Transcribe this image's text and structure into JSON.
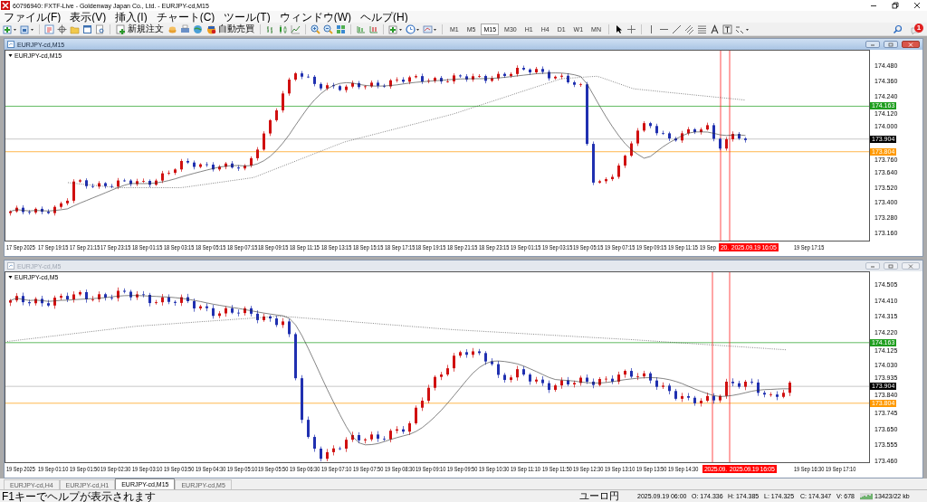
{
  "window": {
    "title": "60796940: FXTF-Live - Goldenway Japan Co., Ltd. - EURJPY-cd,M15"
  },
  "menu": [
    "ファイル(F)",
    "表示(V)",
    "挿入(I)",
    "チャート(C)",
    "ツール(T)",
    "ウィンドウ(W)",
    "ヘルプ(H)"
  ],
  "toolbar": {
    "new_order": "新規注文",
    "auto_trading": "自動売買",
    "notification_badge": "1",
    "timeframes": [
      {
        "label": "M1",
        "selected": false
      },
      {
        "label": "M5",
        "selected": false
      },
      {
        "label": "M15",
        "selected": true
      },
      {
        "label": "M30",
        "selected": false
      },
      {
        "label": "H1",
        "selected": false
      },
      {
        "label": "H4",
        "selected": false
      },
      {
        "label": "D1",
        "selected": false
      },
      {
        "label": "W1",
        "selected": false
      },
      {
        "label": "MN",
        "selected": false
      }
    ]
  },
  "charts": [
    {
      "title": "EURJPY-cd,M15",
      "active": true,
      "label": "EURJPY-cd,M15",
      "price_ticks": [
        "174.480",
        "174.360",
        "174.240",
        "174.120",
        "174.000",
        "173.760",
        "173.640",
        "173.520",
        "173.400",
        "173.280",
        "173.160"
      ],
      "price_tags": [
        {
          "text": "174.163",
          "color": "#1f9e1f"
        },
        {
          "text": "173.904",
          "color": "#000000"
        },
        {
          "text": "173.804",
          "color": "#ff9900"
        }
      ],
      "time_ticks": [
        "17 Sep 2025",
        "17 Sep 19:15",
        "17 Sep 21:15",
        "17 Sep 23:15",
        "18 Sep 01:15",
        "18 Sep 03:15",
        "18 Sep 05:15",
        "18 Sep 07:15",
        "18 Sep 09:15",
        "18 Sep 11:15",
        "18 Sep 13:15",
        "18 Sep 15:15",
        "18 Sep 17:15",
        "18 Sep 19:15",
        "18 Sep 21:15",
        "18 Sep 23:15",
        "19 Sep 01:15",
        "19 Sep 03:15",
        "19 Sep 05:15",
        "19 Sep 07:15",
        "19 Sep 09:15",
        "19 Sep 11:15",
        "19 Sep",
        "19 Sep 17:15"
      ],
      "cursor_labels": [
        "20.",
        "2025.09.19 16:05"
      ]
    },
    {
      "title": "EURJPY-cd,M5",
      "active": false,
      "label": "EURJPY-cd,M5",
      "price_ticks": [
        "174.505",
        "174.410",
        "174.315",
        "174.220",
        "174.125",
        "174.030",
        "173.935",
        "173.840",
        "173.745",
        "173.650",
        "173.555",
        "173.460"
      ],
      "price_tags": [
        {
          "text": "174.163",
          "color": "#1f9e1f"
        },
        {
          "text": "173.904",
          "color": "#000000"
        },
        {
          "text": "173.804",
          "color": "#ff9900"
        }
      ],
      "time_ticks": [
        "19 Sep 2025",
        "19 Sep 01:10",
        "19 Sep 01:50",
        "19 Sep 02:30",
        "19 Sep 03:10",
        "19 Sep 03:50",
        "19 Sep 04:30",
        "19 Sep 05:10",
        "19 Sep 05:50",
        "19 Sep 06:30",
        "19 Sep 07:10",
        "19 Sep 07:50",
        "19 Sep 08:30",
        "19 Sep 09:10",
        "19 Sep 09:50",
        "19 Sep 10:30",
        "19 Sep 11:10",
        "19 Sep 11:50",
        "19 Sep 12:30",
        "19 Sep 13:10",
        "19 Sep 13:50",
        "19 Sep 14:30",
        "19 Sep 16:30",
        "19 Sep 17:10"
      ],
      "cursor_labels": [
        "2025.09.",
        "2025.09.19 16:05"
      ]
    }
  ],
  "tabs": [
    {
      "label": "EURJPY-cd,H4",
      "selected": false
    },
    {
      "label": "EURJPY-cd,H1",
      "selected": false
    },
    {
      "label": "EURJPY-cd,M15",
      "selected": true
    },
    {
      "label": "EURJPY-cd,M5",
      "selected": false
    }
  ],
  "status_bar": {
    "help": "F1キーでヘルプが表示されます",
    "symbol": "ユーロ円",
    "time": "2025.09.19 06:00",
    "open": "O: 174.336",
    "high": "H: 174.385",
    "low": "L: 174.325",
    "close": "C: 174.347",
    "volume": "V: 678",
    "traffic": "13423/22 kb"
  }
}
